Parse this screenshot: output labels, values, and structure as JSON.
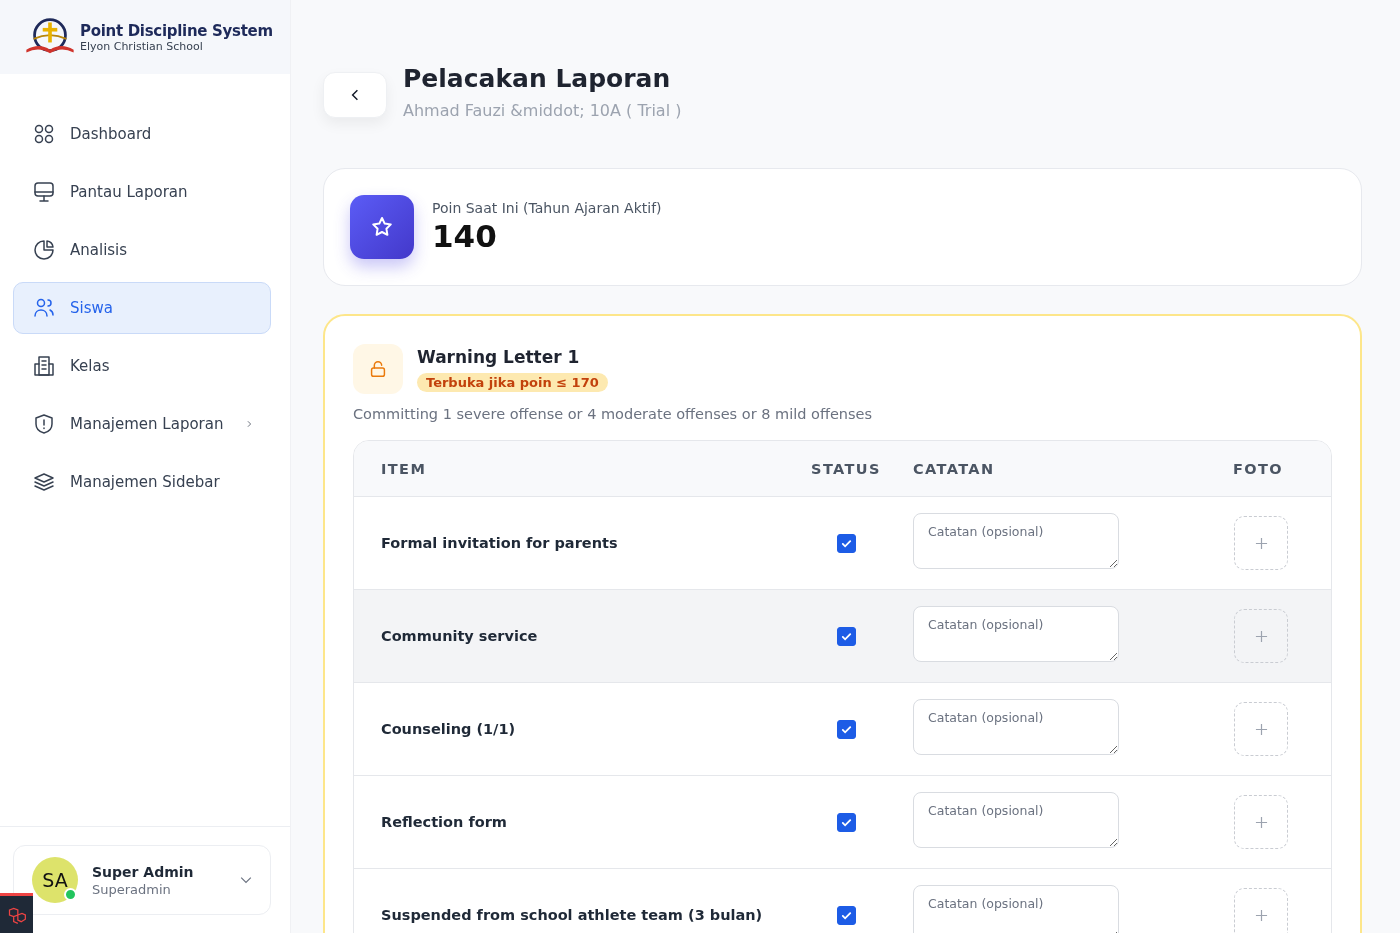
{
  "brand": {
    "title": "Point Discipline System",
    "subtitle": "Elyon Christian School"
  },
  "sidebar": {
    "items": [
      {
        "label": "Dashboard",
        "selected": false,
        "has_submenu": false
      },
      {
        "label": "Pantau Laporan",
        "selected": false,
        "has_submenu": false
      },
      {
        "label": "Analisis",
        "selected": false,
        "has_submenu": false
      },
      {
        "label": "Siswa",
        "selected": true,
        "has_submenu": false
      },
      {
        "label": "Kelas",
        "selected": false,
        "has_submenu": false
      },
      {
        "label": "Manajemen Laporan",
        "selected": false,
        "has_submenu": true
      },
      {
        "label": "Manajemen Sidebar",
        "selected": false,
        "has_submenu": false
      }
    ]
  },
  "user": {
    "initials": "SA",
    "name": "Super Admin",
    "role": "Superadmin",
    "online": true
  },
  "header": {
    "title": "Pelacakan Laporan",
    "subtitle": "Ahmad Fauzi &middot; 10A ( Trial )"
  },
  "points": {
    "label": "Poin Saat Ini (Tahun Ajaran Aktif)",
    "value": "140"
  },
  "letter": {
    "title": "Warning Letter 1",
    "badge": "Terbuka jika poin ≤ 170",
    "locked": false,
    "description": "Committing 1 severe offense or 4 moderate offenses or 8 mild offenses",
    "table": {
      "columns": [
        "ITEM",
        "STATUS",
        "CATATAN",
        "FOTO"
      ],
      "rows": [
        {
          "item": "Formal invitation for parents",
          "checked": true,
          "placeholder": "Catatan (opsional)",
          "highlighted": false
        },
        {
          "item": "Community service",
          "checked": true,
          "placeholder": "Catatan (opsional)",
          "highlighted": true
        },
        {
          "item": "Counseling (1/1)",
          "checked": true,
          "placeholder": "Catatan (opsional)",
          "highlighted": false
        },
        {
          "item": "Reflection form",
          "checked": true,
          "placeholder": "Catatan (opsional)",
          "highlighted": false
        },
        {
          "item": "Suspended from school athlete team (3 bulan)",
          "checked": true,
          "placeholder": "Catatan (opsional)",
          "highlighted": false
        }
      ]
    }
  }
}
